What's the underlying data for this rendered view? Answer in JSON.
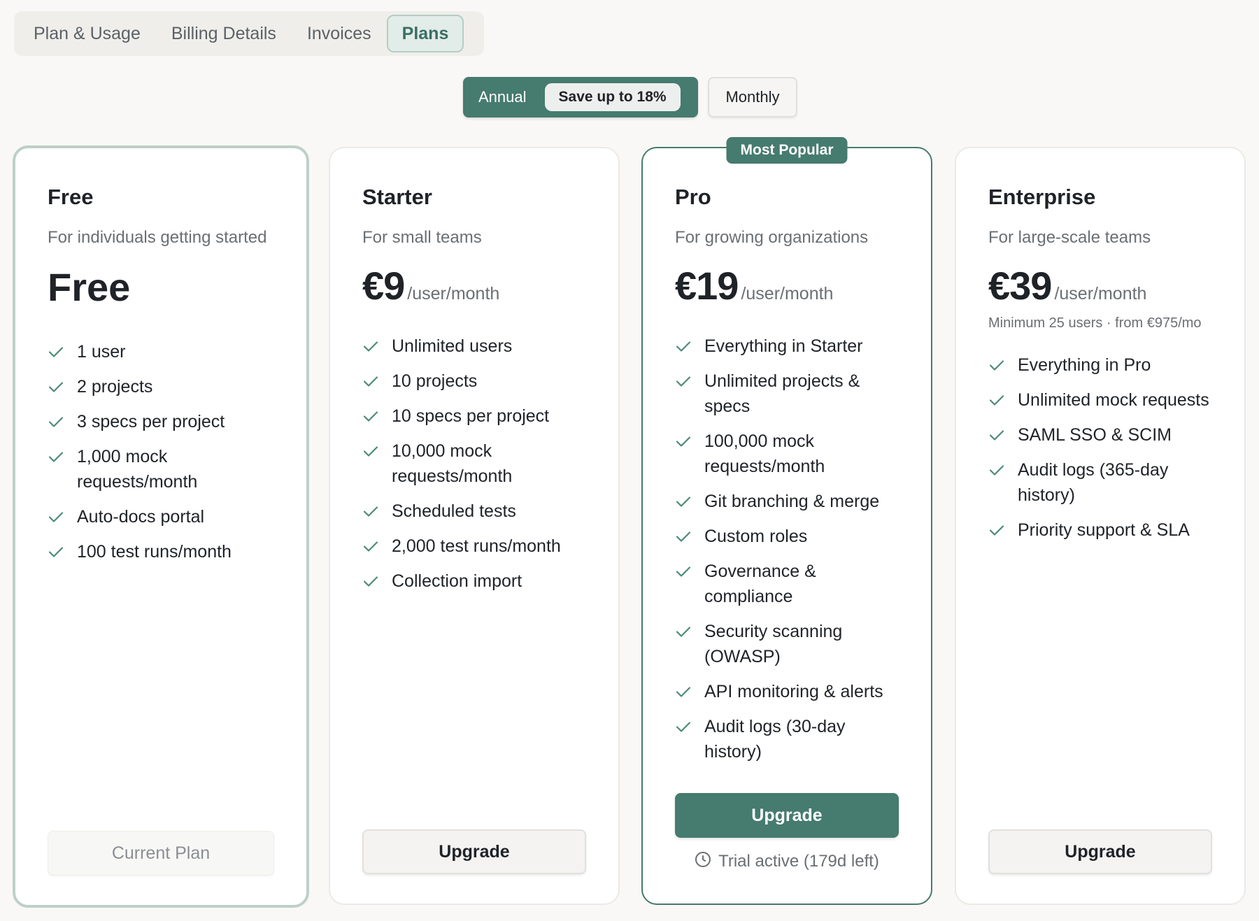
{
  "tabs": {
    "items": [
      {
        "label": "Plan & Usage",
        "active": false
      },
      {
        "label": "Billing Details",
        "active": false
      },
      {
        "label": "Invoices",
        "active": false
      },
      {
        "label": "Plans",
        "active": true
      }
    ]
  },
  "billing_toggle": {
    "annual_label": "Annual",
    "save_label": "Save up to 18%",
    "monthly_label": "Monthly",
    "selected": "Annual"
  },
  "plans": [
    {
      "name": "Free",
      "description": "For individuals getting started",
      "price": "Free",
      "features": [
        "1 user",
        "2 projects",
        "3 specs per project",
        "1,000 mock requests/month",
        "Auto-docs portal",
        "100 test runs/month"
      ],
      "cta": "Current Plan"
    },
    {
      "name": "Starter",
      "description": "For small teams",
      "price": "€9",
      "period": "/user/month",
      "features": [
        "Unlimited users",
        "10 projects",
        "10 specs per project",
        "10,000 mock requests/month",
        "Scheduled tests",
        "2,000 test runs/month",
        "Collection import"
      ],
      "cta": "Upgrade"
    },
    {
      "name": "Pro",
      "badge": "Most Popular",
      "description": "For growing organizations",
      "price": "€19",
      "period": "/user/month",
      "features": [
        "Everything in Starter",
        "Unlimited projects & specs",
        "100,000 mock requests/month",
        "Git branching & merge",
        "Custom roles",
        "Governance & compliance",
        "Security scanning (OWASP)",
        "API monitoring & alerts",
        "Audit logs (30-day history)"
      ],
      "cta": "Upgrade",
      "trial_note": "Trial active (179d left)"
    },
    {
      "name": "Enterprise",
      "description": "For large-scale teams",
      "price": "€39",
      "period": "/user/month",
      "note": "Minimum 25 users · from €975/mo",
      "features": [
        "Everything in Pro",
        "Unlimited mock requests",
        "SAML SSO & SCIM",
        "Audit logs (365-day history)",
        "Priority support & SLA"
      ],
      "cta": "Upgrade"
    }
  ],
  "colors": {
    "accent": "#467b6f",
    "check": "#4c8a7a",
    "background": "#f9f8f6"
  },
  "icons": {
    "feature": "check-icon",
    "trial": "clock-icon"
  }
}
